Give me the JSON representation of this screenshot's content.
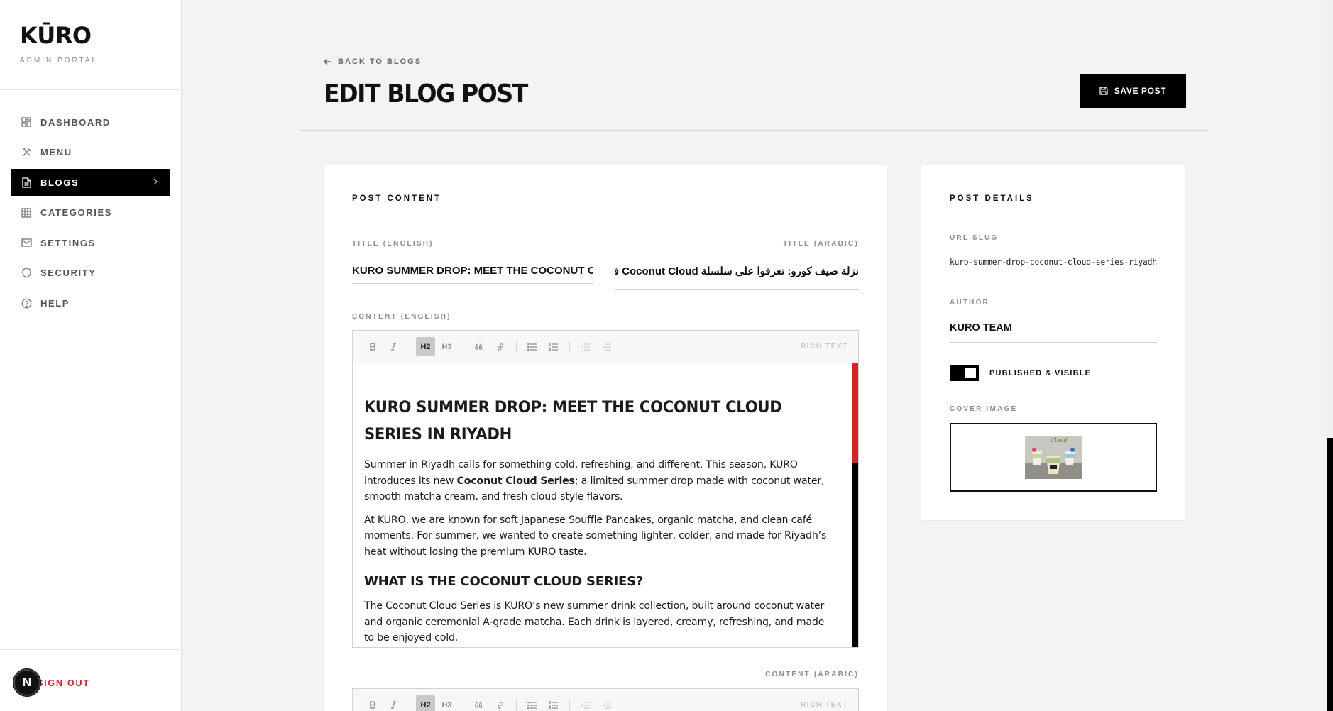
{
  "brand": {
    "logo": "KŪRO",
    "subtitle": "ADMIN PORTAL"
  },
  "sidebar": {
    "items": [
      {
        "label": "DASHBOARD",
        "icon": "dashboard-icon",
        "active": false
      },
      {
        "label": "MENU",
        "icon": "utensils-icon",
        "active": false
      },
      {
        "label": "BLOGS",
        "icon": "document-icon",
        "active": true
      },
      {
        "label": "CATEGORIES",
        "icon": "grid-icon",
        "active": false
      },
      {
        "label": "SETTINGS",
        "icon": "mail-icon",
        "active": false
      },
      {
        "label": "SECURITY",
        "icon": "shield-icon",
        "active": false
      },
      {
        "label": "HELP",
        "icon": "help-icon",
        "active": false
      }
    ],
    "signout": "SIGN OUT",
    "badge": "N"
  },
  "header": {
    "back_label": "BACK TO BLOGS",
    "title": "EDIT BLOG POST",
    "save_label": "SAVE POST"
  },
  "post_content": {
    "section_title": "POST CONTENT",
    "title_en_label": "TITLE (ENGLISH)",
    "title_en_value": "KURO SUMMER DROP: MEET THE COCONUT CLOUD SERIES IN RIYADH",
    "title_ar_label": "TITLE (ARABIC)",
    "title_ar_value": "نزلة صيف كورو: تعرفوا على سلسلة Coconut Cloud في الرياض",
    "content_en_label": "CONTENT (ENGLISH)",
    "content_ar_label": "CONTENT (ARABIC)",
    "toolbar": {
      "bold": "B",
      "italic": "I",
      "h2": "H2",
      "h3": "H3",
      "rich_text": "RICH TEXT"
    },
    "body": {
      "h2": "KURO SUMMER DROP: MEET THE COCONUT CLOUD SERIES IN RIYADH",
      "p1_before": "Summer in Riyadh calls for something cold, refreshing, and different. This season, KURO introduces its new ",
      "p1_bold": "Coconut Cloud Series",
      "p1_after": "; a limited summer drop made with coconut water, smooth matcha cream, and fresh cloud style flavors.",
      "p2": "At KURO, we are known for soft Japanese Souffle Pancakes, organic matcha, and clean café moments. For summer, we wanted to create something lighter, colder, and made for Riyadh’s heat without losing the premium KURO taste.",
      "h3": "WHAT IS THE COCONUT CLOUD SERIES?",
      "p3": "The Coconut Cloud Series is KURO’s new summer drink collection, built around coconut water and organic ceremonial A-grade matcha. Each drink is layered, creamy, refreshing, and made to be enjoyed cold."
    }
  },
  "post_details": {
    "section_title": "POST DETAILS",
    "slug_label": "URL SLUG",
    "slug_value": "kuro-summer-drop-coconut-cloud-series-riyadh",
    "author_label": "AUTHOR",
    "author_value": "KURO TEAM",
    "published_label": "PUBLISHED & VISIBLE",
    "published": true,
    "cover_label": "COVER IMAGE",
    "cover_text": "Cloud"
  },
  "colors": {
    "accent_red": "#d6242c",
    "black": "#000000",
    "bg": "#f3f3f3"
  }
}
